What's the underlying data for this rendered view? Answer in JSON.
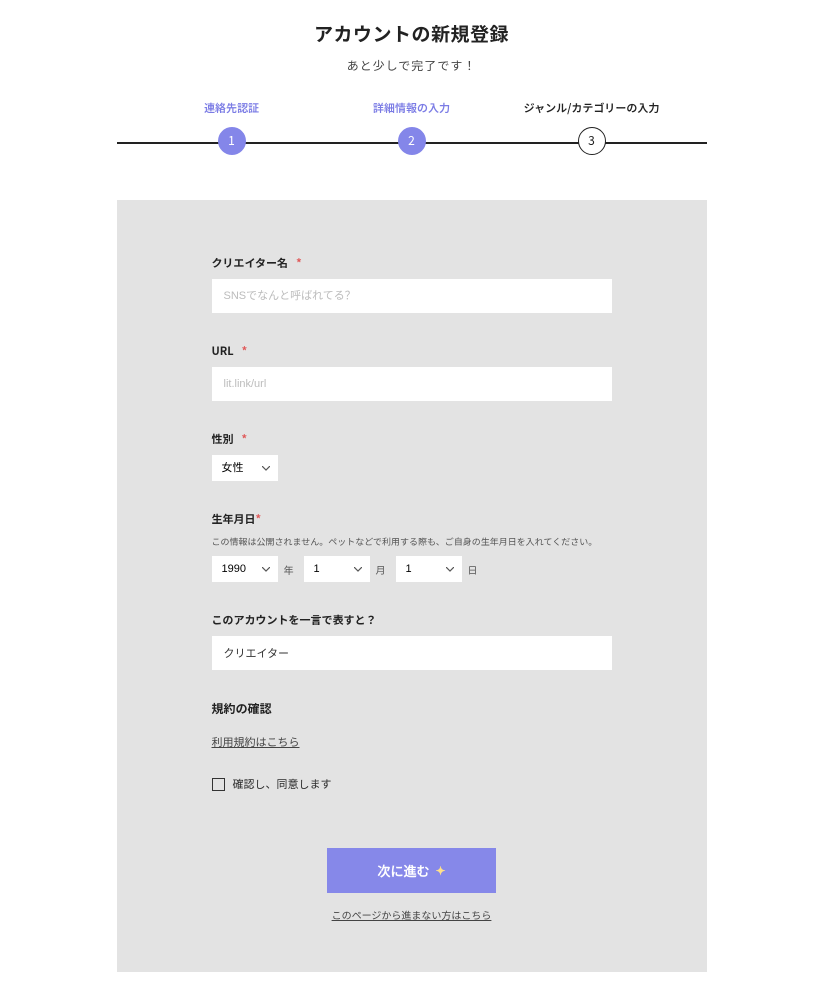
{
  "header": {
    "title": "アカウントの新規登録",
    "subtitle": "あと少しで完了です！"
  },
  "steps": [
    {
      "label": "連絡先認証",
      "num": "1",
      "state": "done"
    },
    {
      "label": "詳細情報の入力",
      "num": "2",
      "state": "done"
    },
    {
      "label": "ジャンル/カテゴリーの入力",
      "num": "3",
      "state": "current"
    }
  ],
  "creator_name": {
    "label": "クリエイター名",
    "required": "*",
    "placeholder": "SNSでなんと呼ばれてる？",
    "value": ""
  },
  "url": {
    "label": "URL",
    "required": "*",
    "placeholder": "lit.link/url",
    "value": ""
  },
  "gender": {
    "label": "性別",
    "required": "*",
    "selected": "女性"
  },
  "dob": {
    "label": "生年月日",
    "required": "*",
    "hint": "この情報は公開されません。ペットなどで利用する際も、ご自身の生年月日を入れてください。",
    "year": "1990",
    "year_unit": "年",
    "month": "1",
    "month_unit": "月",
    "day": "1",
    "day_unit": "日"
  },
  "bio": {
    "label": "このアカウントを一言で表すと？",
    "value": "クリエイター"
  },
  "terms": {
    "heading": "規約の確認",
    "link": "利用規約はこちら",
    "checkbox_label": "確認し、同意します"
  },
  "actions": {
    "submit": "次に進む",
    "alt": "このページから進まない方はこちら"
  }
}
